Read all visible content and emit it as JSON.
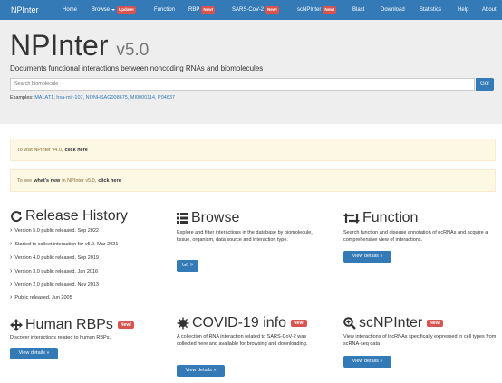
{
  "nav": {
    "brand": "NPInter",
    "items": [
      {
        "label": "Home"
      },
      {
        "label": "Browse",
        "badge": "Update!"
      },
      {
        "label": "Function"
      },
      {
        "label": "RBP",
        "badge": "New!"
      },
      {
        "label": "SARS-CoV-2",
        "badge": "New!"
      },
      {
        "label": "scNPInter",
        "badge": "New!"
      },
      {
        "label": "Blast"
      },
      {
        "label": "Download"
      },
      {
        "label": "Statistics"
      },
      {
        "label": "Help"
      },
      {
        "label": "About"
      }
    ]
  },
  "header": {
    "title": "NPInter",
    "version": "v5.0",
    "subtitle": "Documents functional interactions between noncoding RNAs and biomolecules",
    "search_placeholder": "Search biomolecule",
    "go_label": "Go!",
    "examples_label": "Examples:",
    "examples": "MALAT1, hsa-mir-107, NONHSAG008675, MI0000114, P04637"
  },
  "alerts": {
    "v4_text": "To visit NPInter v4.0,",
    "v4_link": "click here",
    "new_pre": "To see",
    "new_bold": "what's new",
    "new_mid": "in NPInter v5.0,",
    "new_link": "click here"
  },
  "release": {
    "title": "Release History",
    "items": [
      "Version 5.0 public released. Sep 2022",
      "Started to collect interaction for v5.0. Mar 2021",
      "Version 4.0 public released. Sep 2019",
      "Version 3.0 public released. Jan 2016",
      "Version 2.0 public released. Nov 2013",
      "Public released. Jun 2005"
    ]
  },
  "browse": {
    "title": "Browse",
    "text": "Explore and filter interactions in the database by biomolecule, tissue, organism, data source and interaction type.",
    "button": "Go »"
  },
  "function": {
    "title": "Function",
    "text": "Search function and disease annotation of ncRNAs and acquire a comprehensive view of interactions.",
    "button": "View details »"
  },
  "rbps": {
    "title": "Human RBPs",
    "badge": "New!",
    "text": "Discover interactions related to human RBPs.",
    "button": "View details »"
  },
  "covid": {
    "title": "COVID-19 info",
    "badge": "New!",
    "text": "A collection of RNA interaction related to SARS-CoV-2 was collected here and available for browsing and downloading.",
    "button": "View details »"
  },
  "scnp": {
    "title": "scNPInter",
    "badge": "New!",
    "text": "View interactions of lncRNAs specifically expressed in cell types from scRNA-seq data",
    "button": "View details »"
  },
  "colors": {
    "primary": "#337ab7",
    "badge": "#d9534f",
    "alert_bg": "#fcf8e3",
    "jumbotron": "#eeeeee"
  }
}
